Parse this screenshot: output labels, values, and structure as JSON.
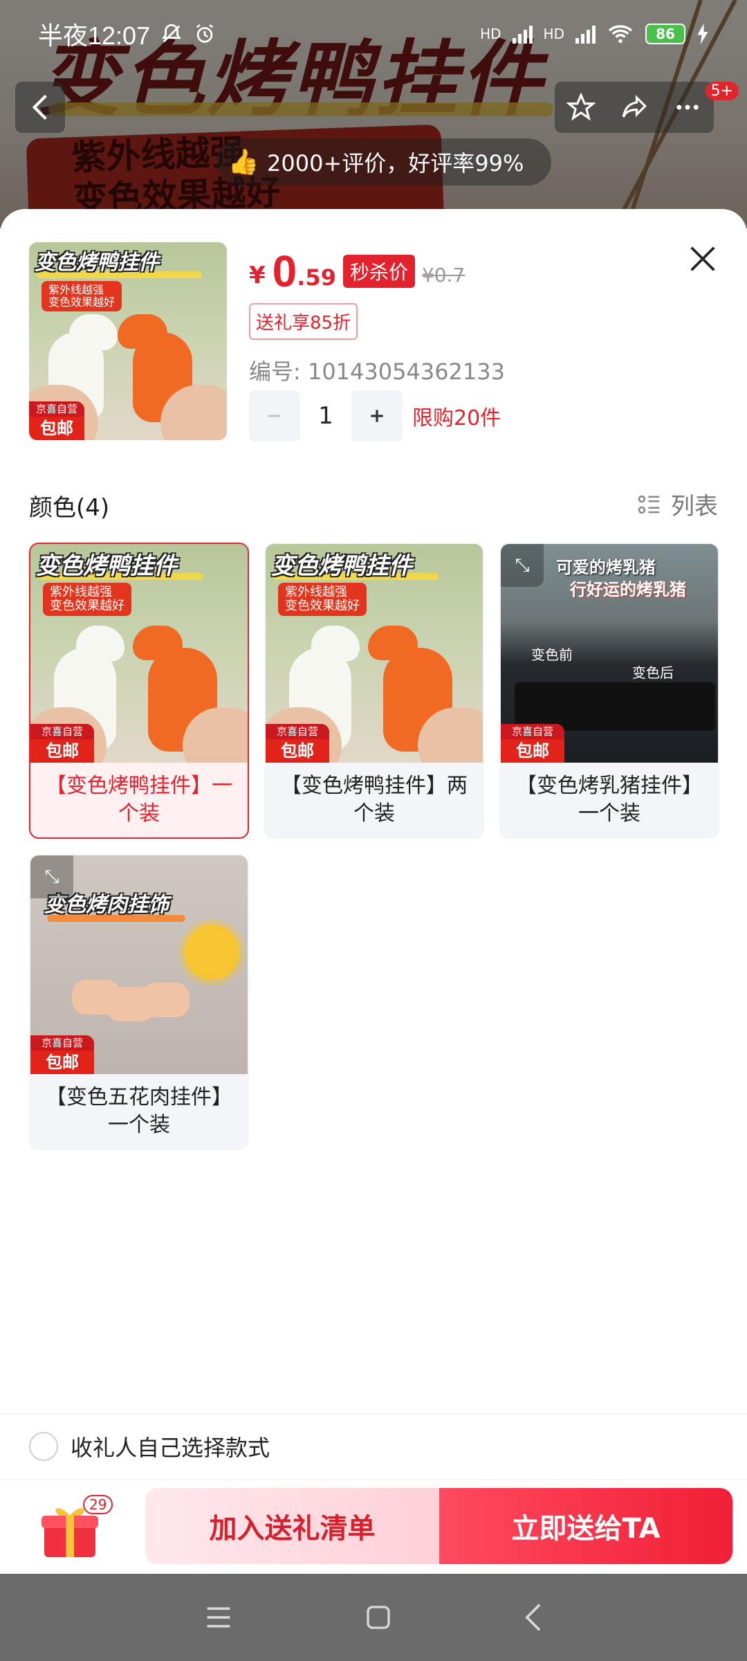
{
  "status_bar": {
    "time": "半夜12:07",
    "network_1": "HD",
    "network_2": "HD",
    "battery": "86"
  },
  "background": {
    "banner_title": "变色烤鸭挂件",
    "banner_sub_1": "紫外线越强",
    "banner_sub_2": "变色效果越好",
    "rating_text": "2000+评价，好评率99%",
    "cart_badge": "5+"
  },
  "product": {
    "image_title": "变色烤鸭挂件",
    "image_sub_1": "紫外线越强",
    "image_sub_2": "变色效果越好",
    "self_op": "京喜自营",
    "free_ship": "包邮",
    "currency": "¥",
    "price_int": "0",
    "price_dec": ".59",
    "flash_label": "秒杀价",
    "original_price": "¥0.7",
    "coupon": "送礼享85折",
    "item_number": "编号: 10143054362133",
    "quantity": "1",
    "limit": "限购20件"
  },
  "section": {
    "title": "颜色(4)",
    "list_toggle": "列表"
  },
  "options": [
    {
      "label": "【变色烤鸭挂件】一个装",
      "selected": true,
      "image_title": "变色烤鸭挂件",
      "sub_1": "紫外线越强",
      "sub_2": "变色效果越好"
    },
    {
      "label": "【变色烤鸭挂件】两个装",
      "selected": false,
      "image_title": "变色烤鸭挂件",
      "sub_1": "紫外线越强",
      "sub_2": "变色效果越好"
    },
    {
      "label": "【变色烤乳猪挂件】一个装",
      "selected": false,
      "image_title_1": "可爱的烤乳猪",
      "image_title_2": "行好运的烤乳猪",
      "before": "变色前",
      "after": "变色后"
    },
    {
      "label": "【变色五花肉挂件】一个装",
      "selected": false,
      "image_title": "变色烤肉挂饰"
    }
  ],
  "tag": {
    "self_op": "京喜自营",
    "free_ship": "包邮"
  },
  "gift_choose": "收礼人自己选择款式",
  "actions": {
    "gift_count": "29",
    "add_list": "加入送礼清单",
    "send_now": "立即送给TA"
  },
  "colors": {
    "accent": "#e3222d",
    "selected_bg": "#fff0f2"
  }
}
